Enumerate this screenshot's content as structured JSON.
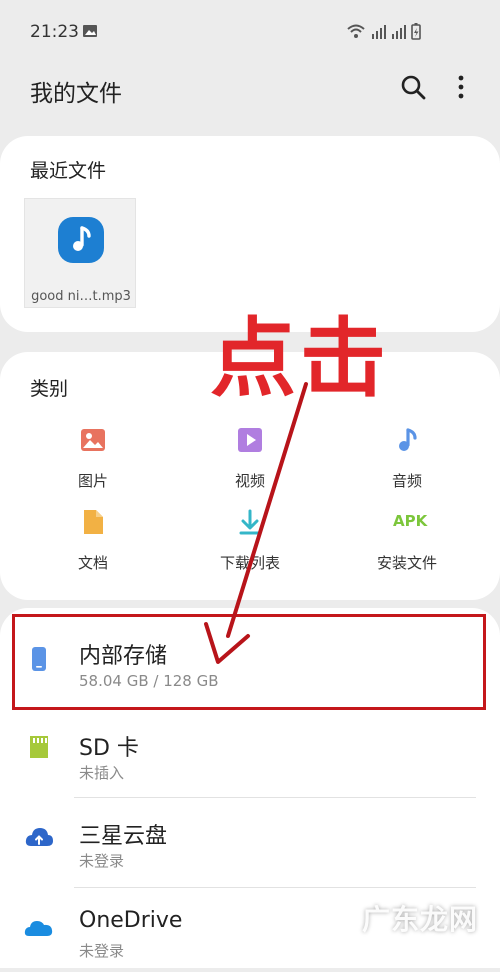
{
  "status_bar": {
    "time": "21:23"
  },
  "app_bar": {
    "title": "我的文件"
  },
  "recent": {
    "title": "最近文件",
    "files": [
      {
        "name": "good ni…t.mp3",
        "icon": "music-note-icon"
      }
    ]
  },
  "categories": {
    "title": "类别",
    "items": [
      {
        "label": "图片",
        "icon": "image-icon",
        "color": "#e8735f"
      },
      {
        "label": "视频",
        "icon": "video-icon",
        "color": "#b07ee0"
      },
      {
        "label": "音频",
        "icon": "audio-icon",
        "color": "#5b94e6"
      },
      {
        "label": "文档",
        "icon": "document-icon",
        "color": "#f2b144"
      },
      {
        "label": "下载列表",
        "icon": "download-icon",
        "color": "#34b6c8"
      },
      {
        "label": "安装文件",
        "icon": "apk-icon",
        "color": "#7cc63b",
        "badge": "APK"
      }
    ]
  },
  "storage": {
    "items": [
      {
        "name": "内部存储",
        "sub": "58.04 GB / 128 GB",
        "icon": "phone-icon"
      },
      {
        "name": "SD 卡",
        "sub": "未插入",
        "icon": "sd-card-icon"
      },
      {
        "name": "三星云盘",
        "sub": "未登录",
        "icon": "samsung-cloud-icon"
      },
      {
        "name": "OneDrive",
        "sub": "未登录",
        "icon": "onedrive-icon"
      }
    ]
  },
  "annotation": {
    "text": "点击",
    "color": "#e2262a"
  },
  "watermark": {
    "text": "广东龙网"
  }
}
